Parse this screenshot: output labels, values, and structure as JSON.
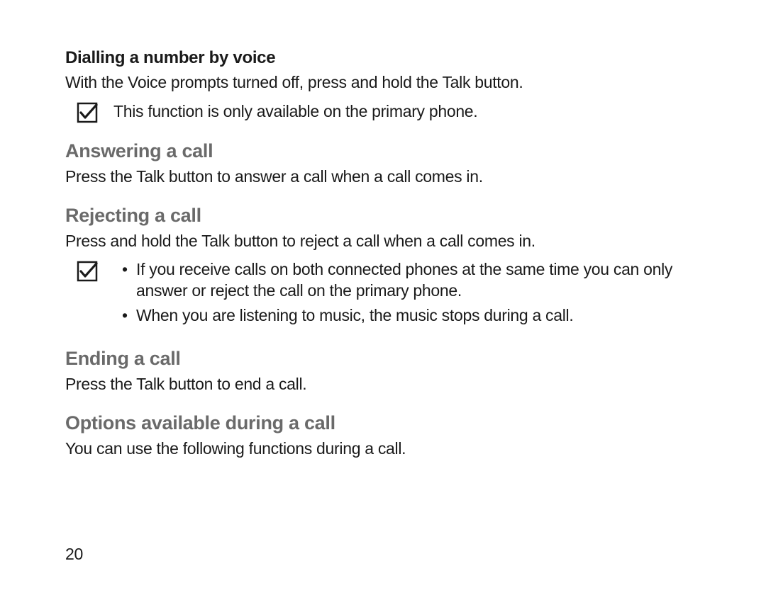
{
  "section_dialling": {
    "heading": "Dialling a number by voice",
    "text": "With the Voice prompts turned off, press and hold the Talk button.",
    "note": "This function is only available on the primary phone."
  },
  "section_answering": {
    "heading": "Answering a call",
    "text": "Press the Talk button to answer a call when a call comes in."
  },
  "section_rejecting": {
    "heading": "Rejecting a call",
    "text": "Press and hold the Talk button to reject a call when a call comes in.",
    "notes": [
      "If you receive calls on both connected phones at the same time you can only answer or reject the call on the primary phone.",
      "When you are listening to music, the music stops during a call."
    ]
  },
  "section_ending": {
    "heading": "Ending a call",
    "text": "Press the Talk button to end a call."
  },
  "section_options": {
    "heading": "Options available during a call",
    "text": "You can use the following functions during a call."
  },
  "page_number": "20"
}
